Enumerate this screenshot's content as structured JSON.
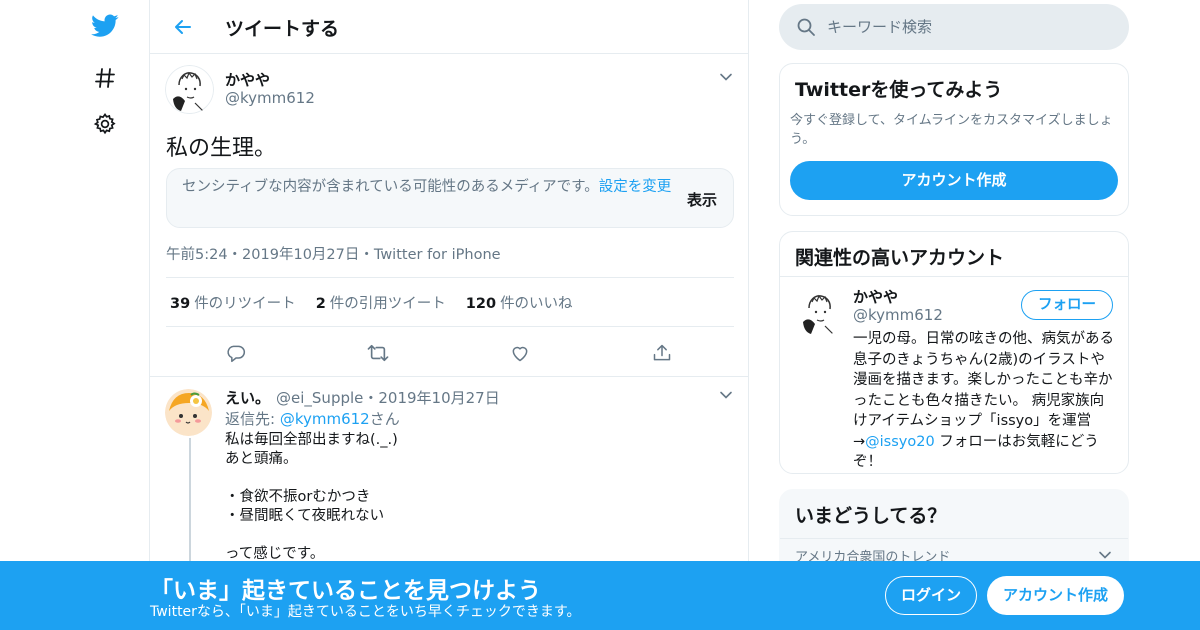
{
  "colors": {
    "accent": "#1da1f2",
    "text": "#14171a",
    "secondary": "#657786",
    "border": "#e6ecf0"
  },
  "nav": {
    "icons": [
      "twitter-bird-icon",
      "hashtag-icon",
      "settings-gear-icon"
    ]
  },
  "header": {
    "title": "ツイートする"
  },
  "tweet": {
    "name": "かやや",
    "handle": "@kymm612",
    "text": "私の生理。",
    "sensitive_text": "センシティブな内容が含まれている可能性のあるメディアです。",
    "sensitive_link": "設定を変更",
    "sensitive_show": "表示",
    "meta": "午前5:24・2019年10月27日・Twitter for iPhone",
    "stats": [
      {
        "count": "39",
        "label": "件のリツイート"
      },
      {
        "count": "2",
        "label": "件の引用ツイート"
      },
      {
        "count": "120",
        "label": "件のいいね"
      }
    ]
  },
  "reply": {
    "name": "えい。",
    "handle_date": "@ei_Supple・2019年10月27日",
    "to_prefix": "返信先: ",
    "to_link": "@kymm612",
    "to_suffix": "さん",
    "body": "私は毎回全部出ますね(._.)\nあと頭痛。\n\n・食欲不振orむかつき\n・昼間眠くて夜眠れない\n\nって感じです。"
  },
  "search": {
    "placeholder": "キーワード検索"
  },
  "signup_card": {
    "title": "Twitterを使ってみよう",
    "subtitle": "今すぐ登録して、タイムラインをカスタマイズしましょう。",
    "button": "アカウント作成"
  },
  "related_card": {
    "title": "関連性の高いアカウント",
    "name": "かやや",
    "handle": "@kymm612",
    "follow": "フォロー",
    "bio_pre": "一児の母。日常の呟きの他、病気がある息子のきょうちゃん(2歳)のイラストや漫画を描きます。楽しかったことも辛かったことも色々描きたい。 病児家族向けアイテムショップ「issyo」を運営→",
    "bio_link": "@issyo20",
    "bio_post": " フォローはお気軽にどうぞ！"
  },
  "trend_card": {
    "title": "いまどうしてる？",
    "subtitle": "アメリカ合衆国のトレンド"
  },
  "bottom_bar": {
    "title": "「いま」起きていることを見つけよう",
    "subtitle": "Twitterなら、「いま」起きていることをいち早くチェックできます。",
    "login": "ログイン",
    "signup": "アカウント作成"
  }
}
